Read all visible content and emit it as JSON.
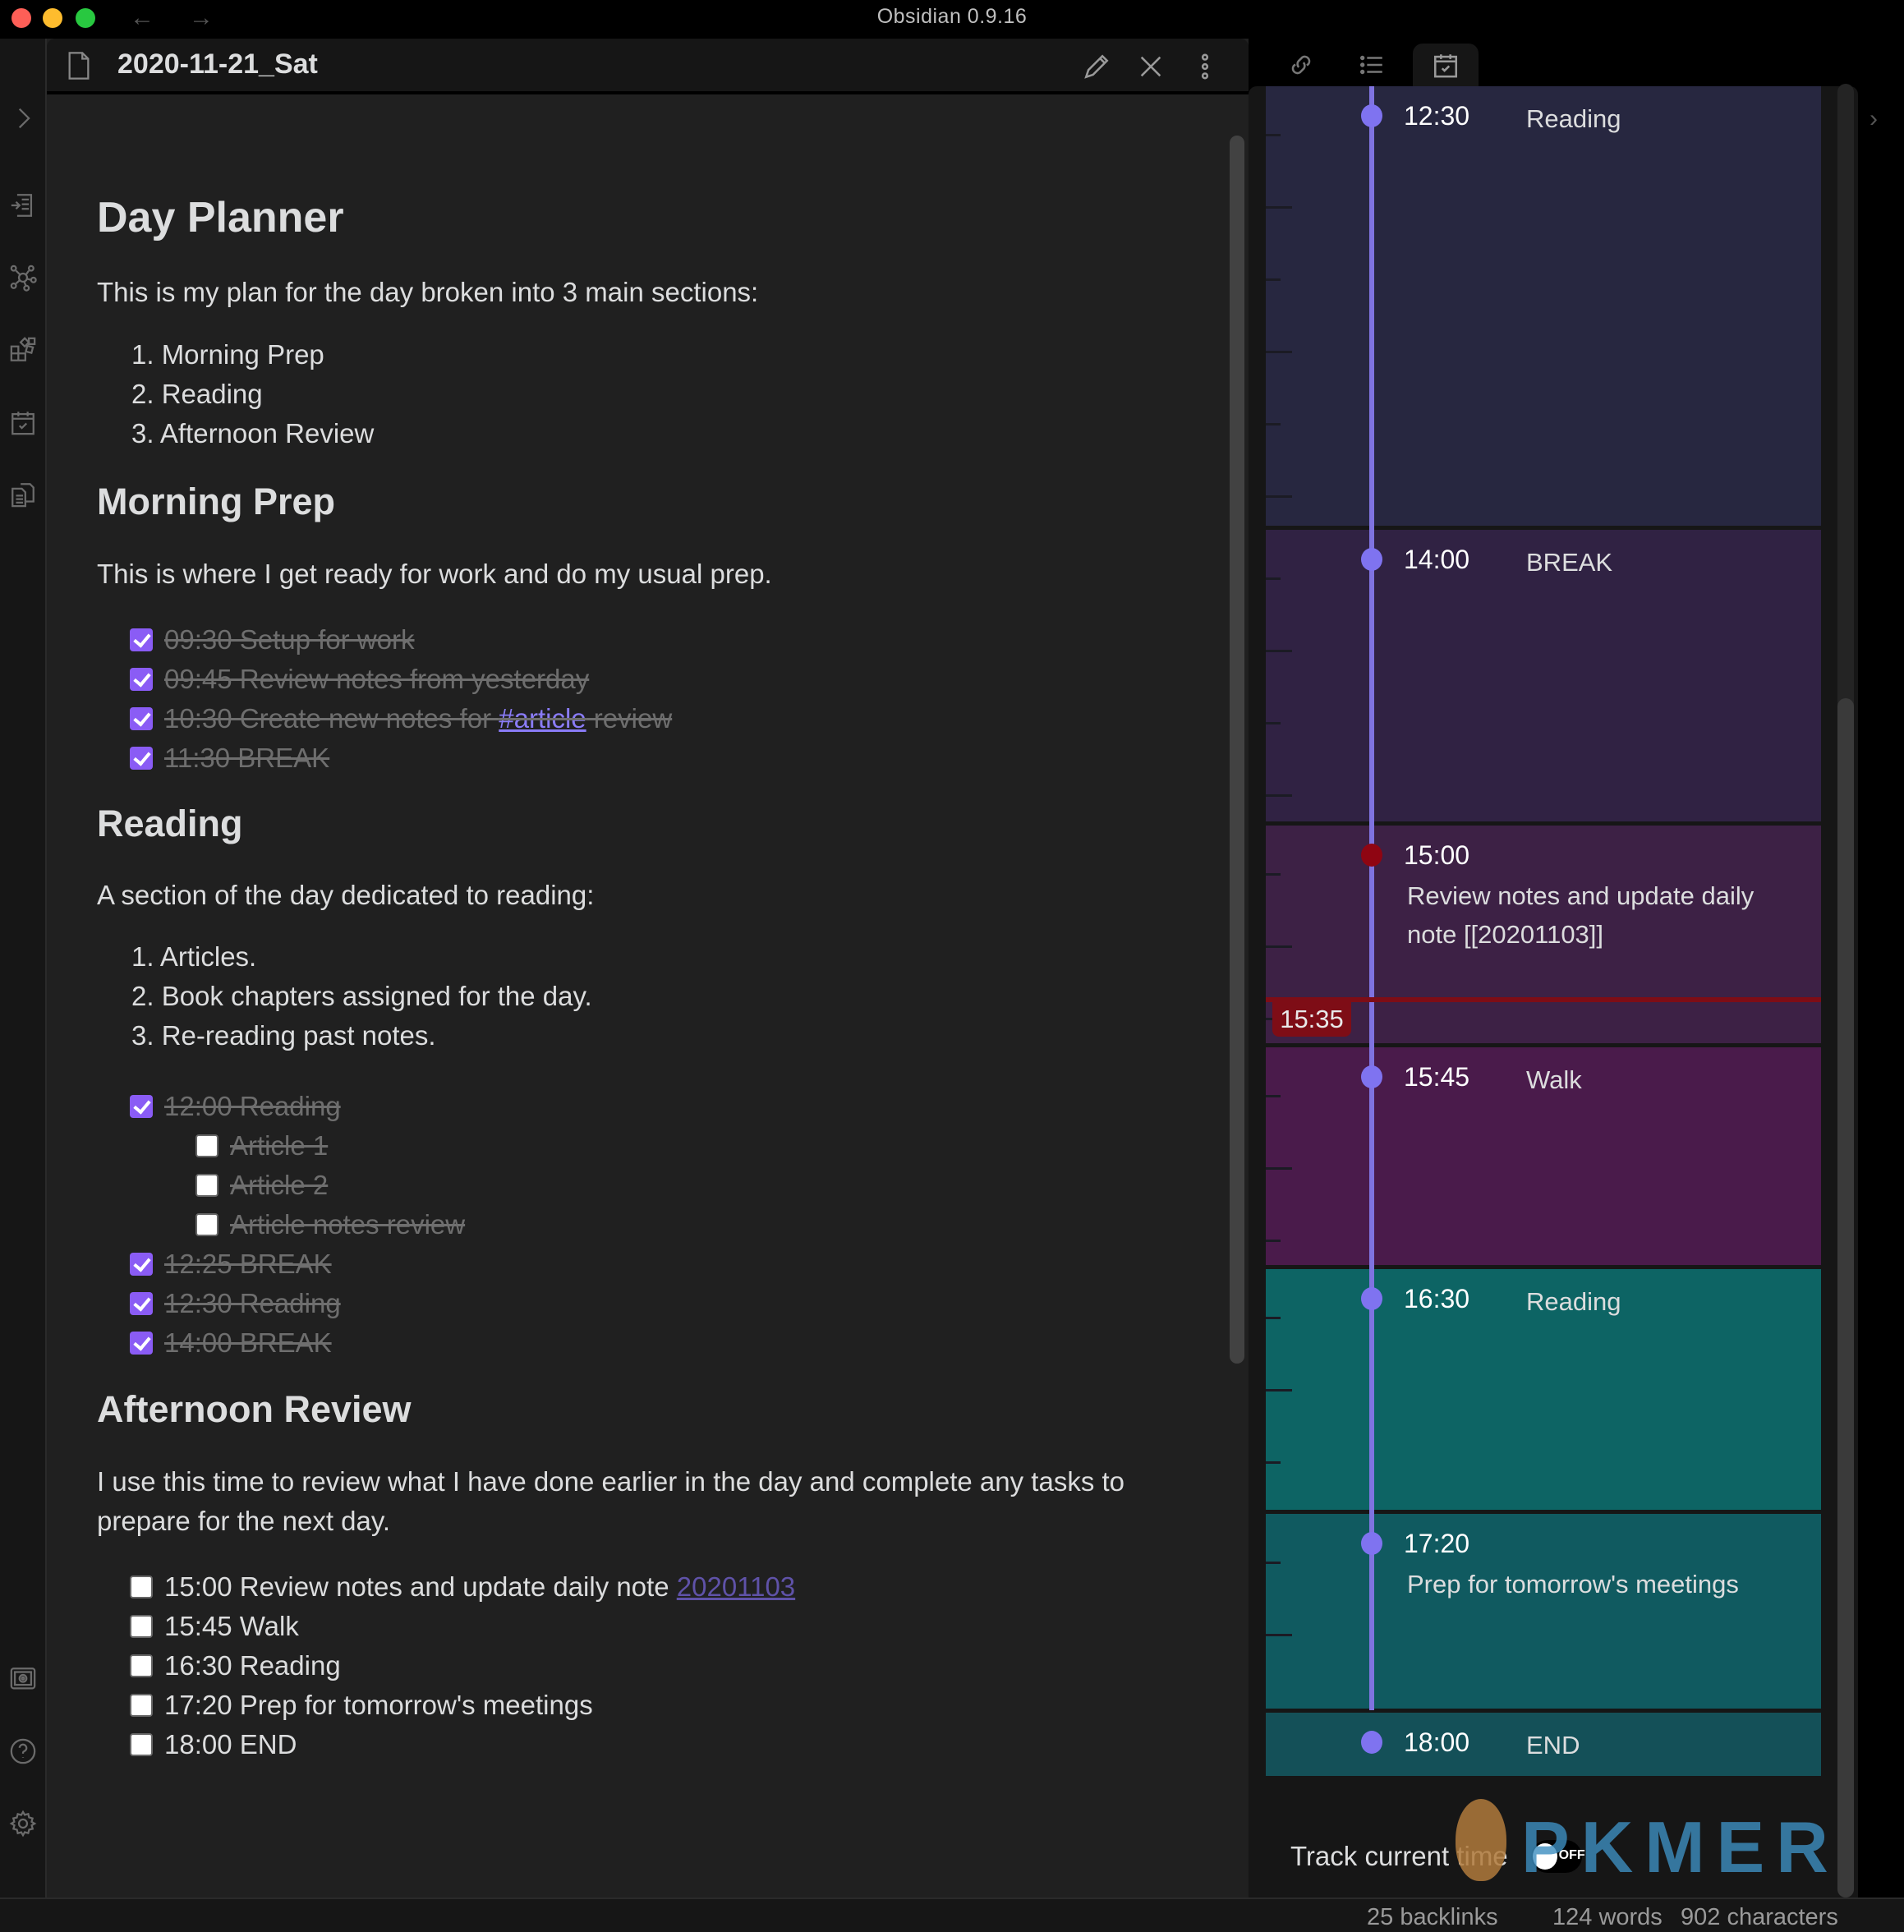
{
  "window": {
    "title": "Obsidian 0.9.16",
    "nav_back": "←",
    "nav_forward": "→"
  },
  "ribbon": {
    "items": [
      {
        "name": "expand-sidebar",
        "icon": "chevron-right-icon"
      },
      {
        "name": "open-quick-switcher",
        "icon": "quick-switcher-icon"
      },
      {
        "name": "open-graph-view",
        "icon": "graph-icon"
      },
      {
        "name": "open-kanban",
        "icon": "blocks-icon"
      },
      {
        "name": "open-daily-note",
        "icon": "calendar-check-icon"
      },
      {
        "name": "insert-template",
        "icon": "copy-document-icon"
      },
      {
        "name": "open-vault",
        "icon": "vault-icon"
      },
      {
        "name": "help",
        "icon": "help-icon"
      },
      {
        "name": "settings",
        "icon": "gear-icon"
      }
    ]
  },
  "editor": {
    "note_title": "2020-11-21_Sat",
    "h1": "Day Planner",
    "intro": "This is my plan for the day broken into 3 main sections:",
    "sections_list": [
      "1. Morning Prep",
      "2. Reading",
      "3. Afternoon Review"
    ],
    "morning": {
      "heading": "Morning Prep",
      "text": "This is where I get ready for work and do my usual prep.",
      "tasks": [
        {
          "text": "09:30 Setup for work",
          "done": true
        },
        {
          "text": "09:45 Review notes from yesterday",
          "done": true
        },
        {
          "text_before": "10:30 Create new notes for ",
          "tag": "#article",
          "text_after": " review",
          "done": true
        },
        {
          "text": "11:30 BREAK",
          "done": true
        }
      ]
    },
    "reading": {
      "heading": "Reading",
      "text": "A section of the day dedicated to reading:",
      "list": [
        "1. Articles.",
        "2. Book chapters assigned for the day.",
        "3. Re-reading past notes."
      ],
      "tasks": [
        {
          "text": "12:00 Reading",
          "done": true,
          "level": 0
        },
        {
          "text": "Article 1",
          "done": false,
          "strike": true,
          "level": 1
        },
        {
          "text": "Article 2",
          "done": false,
          "strike": true,
          "level": 1
        },
        {
          "text": "Article notes review",
          "done": false,
          "strike": true,
          "level": 1
        },
        {
          "text": "12:25 BREAK",
          "done": true,
          "level": 0
        },
        {
          "text": "12:30 Reading",
          "done": true,
          "level": 0
        },
        {
          "text": "14:00 BREAK",
          "done": true,
          "level": 0
        }
      ]
    },
    "afternoon": {
      "heading": "Afternoon Review",
      "text": "I use this time to review what I have done earlier in the day and complete any tasks to prepare for the next day.",
      "tasks": [
        {
          "text": "15:00 Review notes and update daily note ",
          "link": "20201103",
          "done": false
        },
        {
          "text": "15:45 Walk",
          "done": false
        },
        {
          "text": "16:30 Reading",
          "done": false
        },
        {
          "text": "17:20 Prep for tomorrow's meetings",
          "done": false
        },
        {
          "text": "18:00 END",
          "done": false
        }
      ]
    }
  },
  "right_pane": {
    "tabs": [
      {
        "name": "backlinks",
        "icon": "link-icon",
        "active": false
      },
      {
        "name": "outline",
        "icon": "list-icon",
        "active": false
      },
      {
        "name": "day-planner",
        "icon": "calendar-check-icon",
        "active": true
      }
    ],
    "timeline": {
      "items": [
        {
          "time": "12:30",
          "label": "Reading",
          "color": "#272740",
          "current": false,
          "wrap": false
        },
        {
          "time": "14:00",
          "label": "BREAK",
          "color": "#302243",
          "current": false,
          "wrap": false
        },
        {
          "time": "15:00",
          "label": "Review notes and update daily note [[20201103]]",
          "color": "#3d2145",
          "current": true,
          "wrap": true
        },
        {
          "time": "15:45",
          "label": "Walk",
          "color": "#4a1b4b",
          "current": false,
          "wrap": false
        },
        {
          "time": "16:30",
          "label": "Reading",
          "color": "#0d6464",
          "current": false,
          "wrap": false
        },
        {
          "time": "17:20",
          "label": "Prep for tomorrow's meetings",
          "color": "#105a60",
          "current": false,
          "wrap": true
        },
        {
          "time": "18:00",
          "label": "END",
          "color": "#145058",
          "current": false,
          "wrap": false
        }
      ],
      "now": "15:35",
      "accent": "#7f73f0",
      "now_color": "#7e0d16"
    },
    "track_current_time": {
      "label": "Track current time",
      "state": "OFF"
    }
  },
  "status_bar": {
    "backlinks": "25 backlinks",
    "words": "124 words",
    "characters": "902 characters"
  },
  "watermark": "PKMER"
}
